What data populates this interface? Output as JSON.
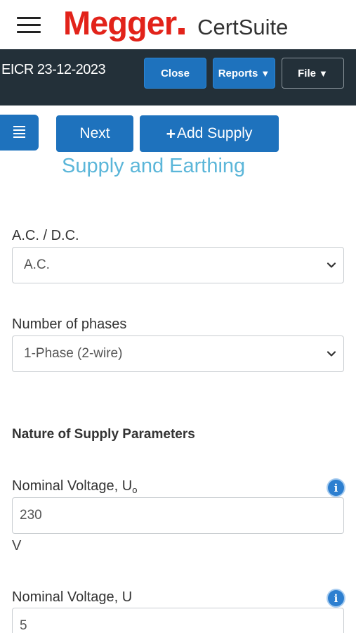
{
  "brand": {
    "name": "Megger",
    "product": "CertSuite",
    "color": "#e2231a"
  },
  "toolbar": {
    "doc_title": "EICR 23-12-2023",
    "close_label": "Close",
    "reports_label": "Reports",
    "file_label": "File",
    "caret": "▼"
  },
  "actions": {
    "next_label": "Next",
    "add_supply_label": "Add Supply",
    "plus": "+"
  },
  "section_title": "Supply and Earthing",
  "form": {
    "acdc": {
      "label": "A.C. / D.C.",
      "value": "A.C."
    },
    "phases": {
      "label": "Number of phases",
      "value": "1-Phase (2-wire)"
    },
    "params_heading": "Nature of Supply Parameters",
    "nominal_u0": {
      "label": "Nominal Voltage, U",
      "subscript": "o",
      "value": "230",
      "unit": "V"
    },
    "nominal_u": {
      "label": "Nominal Voltage, U",
      "value": "5"
    }
  },
  "colors": {
    "accent": "#1e72bd",
    "toolbar_bg": "#233039",
    "section_title": "#5bb6d9",
    "info": "#2d7fd0"
  }
}
